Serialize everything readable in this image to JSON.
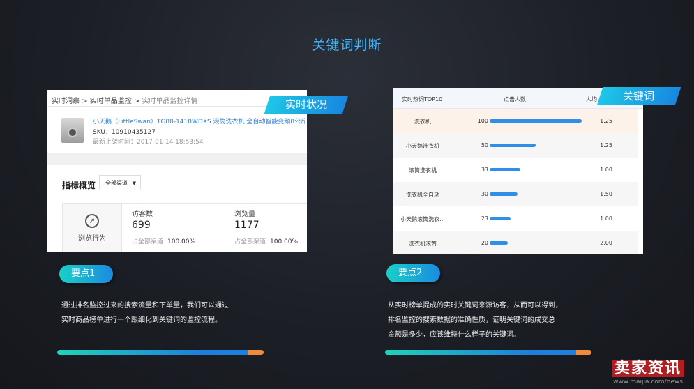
{
  "title": "关键词判断",
  "shot1": {
    "breadcrumb": [
      "实时洞察",
      "实时单品监控",
      "实时单品监控详情"
    ],
    "sep": ">",
    "product_name": "小天鹅（LittleSwan）TG80-1410WDXS 滚筒洗衣机 全自动智能变频8公斤",
    "sku": "SKU：10910435127",
    "listing_time": "最新上架时间：2017-01-14 18:53:54",
    "overview_title": "指标概览",
    "channel_select": "全部渠道",
    "behavior_label": "浏览行为",
    "metrics": [
      {
        "label": "访客数",
        "value": "699",
        "sub_label": "占全部渠道",
        "sub_value": "100.00%"
      },
      {
        "label": "浏览量",
        "value": "1177",
        "sub_label": "占全部渠道",
        "sub_value": "100.00%"
      }
    ]
  },
  "tag1": "实时状况",
  "tag2": "关键词",
  "shot2": {
    "headers": [
      "实时热词TOP10",
      "点击人数",
      "人均"
    ],
    "rows": [
      {
        "keyword": "洗衣机",
        "count": 100,
        "avg": "1.25"
      },
      {
        "keyword": "小天鹅洗衣机",
        "count": 50,
        "avg": "1.25"
      },
      {
        "keyword": "滚筒洗衣机",
        "count": 33,
        "avg": "1.00"
      },
      {
        "keyword": "洗衣机全自动",
        "count": 30,
        "avg": "1.50"
      },
      {
        "keyword": "小天鹅滚筒洗衣...",
        "count": 23,
        "avg": "1.00"
      },
      {
        "keyword": "洗衣机滚筒",
        "count": 20,
        "avg": "2.00"
      }
    ]
  },
  "point1": {
    "label": "要点1",
    "lines": [
      "通过排名监控过来的搜索流量和下单量，我们可以通过",
      "实时商品榜单进行一个跟细化到关键词的监控流程。"
    ]
  },
  "point2": {
    "label": "要点2",
    "lines": [
      "从实时榜单提成的实时关键词来源访客，从而可以得到，",
      "排名监控的搜索数据的准确性质，证明关键词的成交总",
      "金额是多少，应该维持什么样子的关键词。"
    ]
  },
  "watermark": {
    "brand": "卖家资讯",
    "url": "www.maijia.com/news"
  },
  "colors": {
    "accent": "#3fb8ff",
    "bar_blue": "#2e8fe6",
    "bar_orange": "#f08a3c"
  }
}
